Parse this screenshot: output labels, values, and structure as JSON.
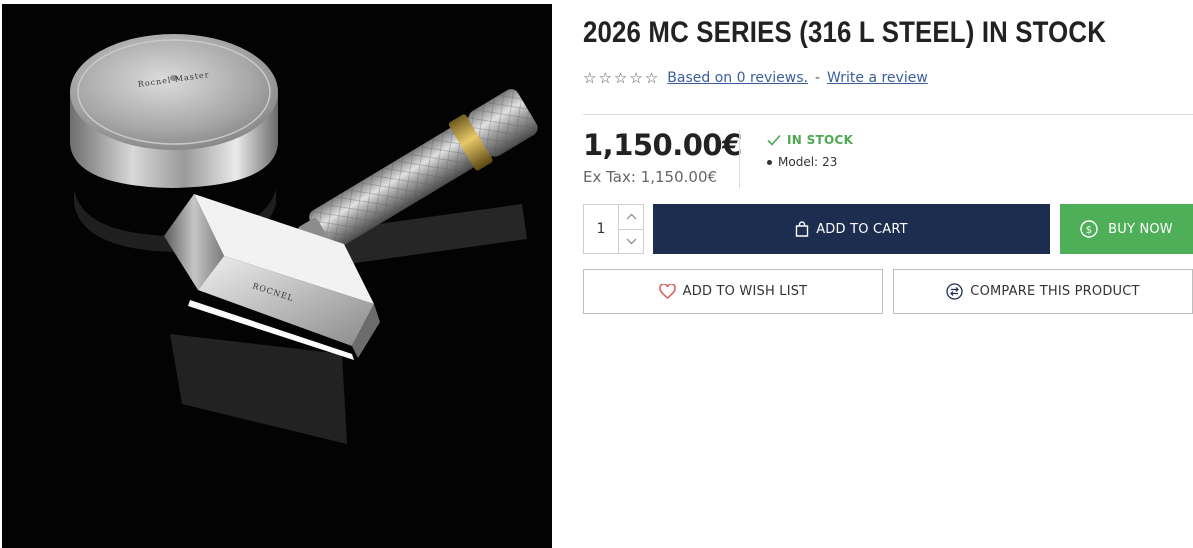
{
  "product": {
    "title": "2026 MC SERIES (316 L STEEL) IN STOCK",
    "image": {
      "alt_engraving_lid": "Rocnel Master Collection",
      "alt_engraving_head": "ROCNEL"
    }
  },
  "rating": {
    "stars_filled": 0,
    "stars_total": 5,
    "reviews_link": "Based on 0 reviews.",
    "separator": "-",
    "write_review_link": "Write a review"
  },
  "pricing": {
    "price": "1,150.00€",
    "ex_tax": "Ex Tax: 1,150.00€"
  },
  "stock": {
    "status": "IN STOCK",
    "model_label": "Model:",
    "model_value": "23"
  },
  "quantity": {
    "value": "1"
  },
  "buttons": {
    "add_to_cart": "ADD TO CART",
    "buy_now": "BUY NOW",
    "wishlist": "ADD TO WISH LIST",
    "compare": "COMPARE THIS PRODUCT"
  },
  "colors": {
    "cart_bg": "#1c2d4f",
    "buy_bg": "#4faf58",
    "stock_green": "#4ea852",
    "link_blue": "#3a5e9c",
    "wish_heart": "#d9534f",
    "compare_icon": "#1c2d4f"
  },
  "icons": {
    "cart": "shopping-bag-icon",
    "buy": "dollar-circle-icon",
    "wishlist": "heart-icon",
    "compare": "compare-arrows-icon",
    "stock": "check-icon"
  }
}
